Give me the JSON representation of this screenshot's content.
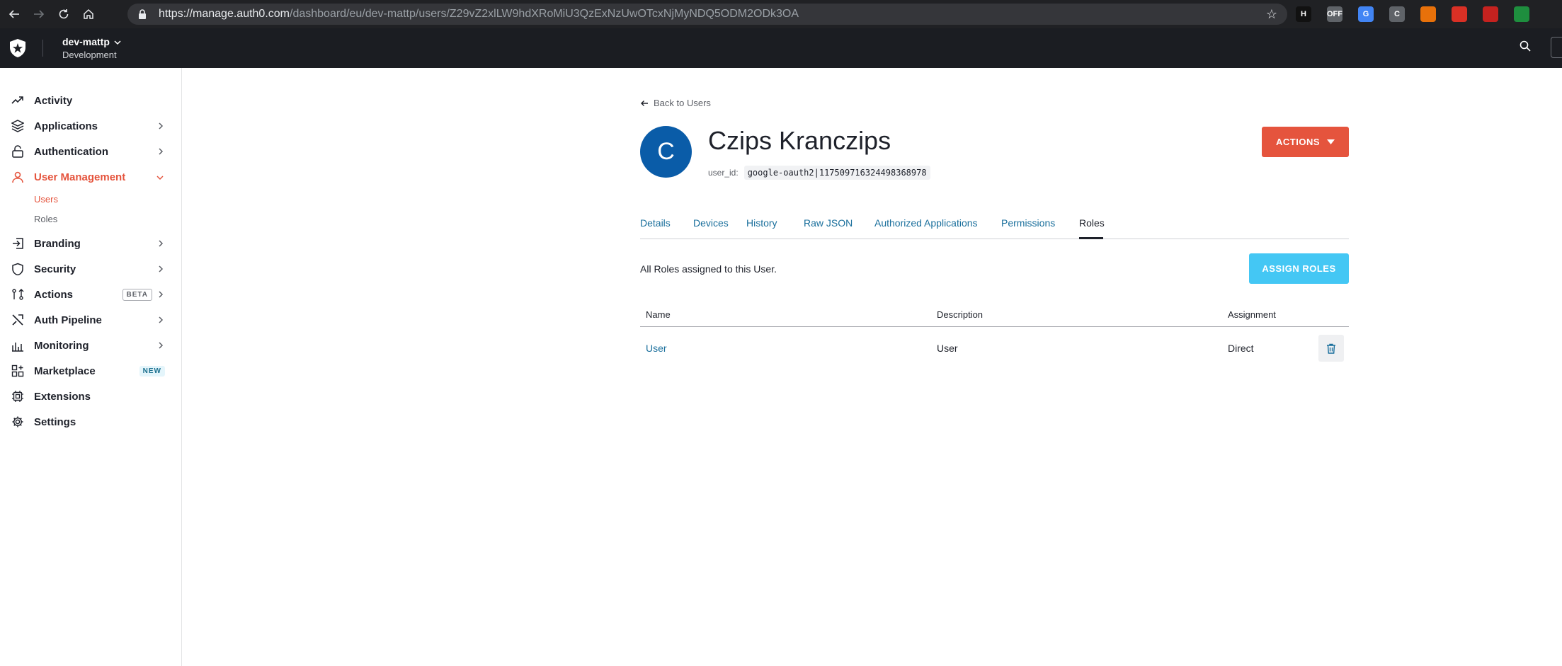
{
  "browser": {
    "url_host": "https://manage.auth0.com",
    "url_path": "/dashboard/eu/dev-mattp/users/Z29vZ2xlLW9hdXRoMiU3QzExNzUwOTcxNjMyNDQ5ODM2ODk3OA",
    "extensions": [
      {
        "icon": "h-extension-icon",
        "label": "H",
        "color": "#111111"
      },
      {
        "icon": "toggle-extension-icon",
        "label": "OFF",
        "color": "#5f6368"
      },
      {
        "icon": "translate-extension-icon",
        "label": "G",
        "color": "#4285f4"
      },
      {
        "icon": "c-extension-icon",
        "label": "C",
        "color": "#5f6368"
      },
      {
        "icon": "firefox-extension-icon",
        "label": "",
        "color": "#e8710a"
      },
      {
        "icon": "red-extension-icon",
        "label": "",
        "color": "#d93025"
      },
      {
        "icon": "red-square-extension-icon",
        "label": "",
        "color": "#c5221f"
      },
      {
        "icon": "green-extension-icon",
        "label": "",
        "color": "#1e8e3e"
      }
    ]
  },
  "header": {
    "tenant_name": "dev-mattp",
    "tenant_env": "Development"
  },
  "sidebar": {
    "items": [
      {
        "label": "Activity",
        "icon": "activity-icon",
        "has_chevron": false
      },
      {
        "label": "Applications",
        "icon": "applications-icon",
        "has_chevron": true
      },
      {
        "label": "Authentication",
        "icon": "lock-icon",
        "has_chevron": true
      },
      {
        "label": "User Management",
        "icon": "user-icon",
        "has_chevron": true,
        "active": true
      },
      {
        "label": "Branding",
        "icon": "branding-icon",
        "has_chevron": true
      },
      {
        "label": "Security",
        "icon": "shield-icon",
        "has_chevron": true
      },
      {
        "label": "Actions",
        "icon": "actions-icon",
        "has_chevron": true,
        "badge": "BETA"
      },
      {
        "label": "Auth Pipeline",
        "icon": "pipeline-icon",
        "has_chevron": true
      },
      {
        "label": "Monitoring",
        "icon": "monitoring-icon",
        "has_chevron": true
      },
      {
        "label": "Marketplace",
        "icon": "marketplace-icon",
        "has_chevron": false,
        "badge": "NEW"
      },
      {
        "label": "Extensions",
        "icon": "extensions-icon",
        "has_chevron": false
      },
      {
        "label": "Settings",
        "icon": "settings-icon",
        "has_chevron": false
      }
    ],
    "sub_items": [
      {
        "label": "Users",
        "active": true
      },
      {
        "label": "Roles",
        "active": false
      }
    ]
  },
  "user": {
    "back_label": "Back to Users",
    "avatar_letter": "C",
    "name": "Czips Kranczips",
    "id_label": "user_id:",
    "id_value": "google-oauth2|117509716324498368978",
    "actions_label": "ACTIONS"
  },
  "tabs": [
    "Details",
    "Devices",
    "History",
    "Raw JSON",
    "Authorized Applications",
    "Permissions",
    "Roles"
  ],
  "active_tab": "Roles",
  "roles": {
    "description": "All Roles assigned to this User.",
    "assign_label": "ASSIGN ROLES",
    "columns": [
      "Name",
      "Description",
      "Assignment"
    ],
    "rows": [
      {
        "name": "User",
        "description": "User",
        "assignment": "Direct"
      }
    ]
  },
  "colors": {
    "accent": "#e5543d",
    "assign": "#44c7f4",
    "avatar": "#0a5ca8",
    "link": "#1a6f9c"
  }
}
